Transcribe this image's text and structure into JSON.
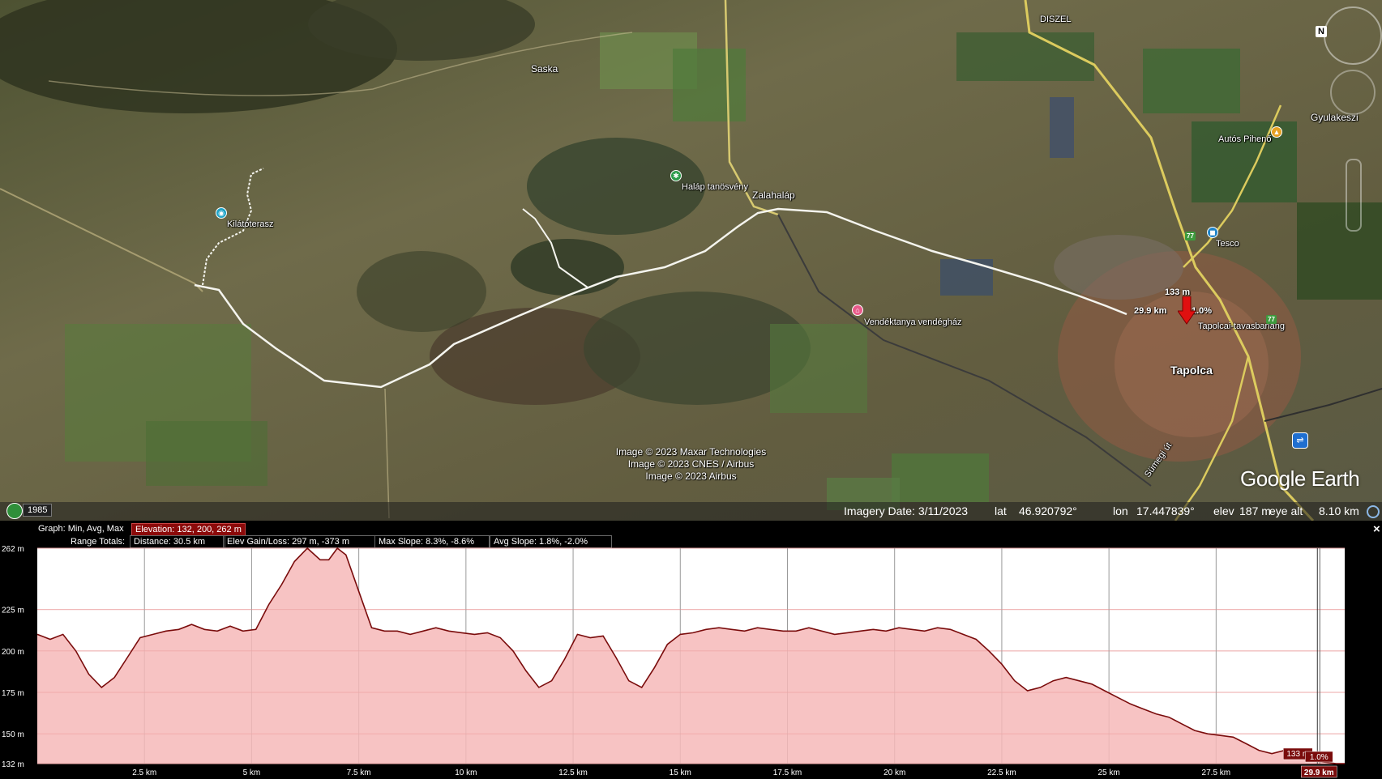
{
  "map": {
    "places": [
      {
        "name": "Saska",
        "kind": "town"
      },
      {
        "name": "DISZEL",
        "kind": "village"
      },
      {
        "name": "Gyulakeszi",
        "kind": "town"
      },
      {
        "name": "Autós Pihenő",
        "kind": "poi"
      },
      {
        "name": "Kilátóterasz",
        "kind": "poi"
      },
      {
        "name": "Haláp tanösvény",
        "kind": "poi"
      },
      {
        "name": "Zalahaláp",
        "kind": "town"
      },
      {
        "name": "Tesco",
        "kind": "poi"
      },
      {
        "name": "Vendéktanya vendégház",
        "kind": "poi"
      },
      {
        "name": "Tapolcai-tavasbarlang",
        "kind": "poi"
      },
      {
        "name": "Tapolca",
        "kind": "town"
      },
      {
        "name": "Sümegi út",
        "kind": "road"
      }
    ],
    "highway_shields": [
      "77",
      "77"
    ],
    "cursor_readout": {
      "elevation": "133 m",
      "distance": "29.9 km",
      "slope": "1.0%"
    },
    "credits": [
      "Image © 2023 Maxar Technologies",
      "Image © 2023 CNES / Airbus",
      "Image © 2023 Airbus"
    ],
    "logo": "Google Earth",
    "nav_north": "N"
  },
  "statusbar": {
    "history_year": "1985",
    "imagery_date": "Imagery Date: 3/11/2023",
    "lat_label": "lat",
    "lat": "46.920792°",
    "lon_label": "lon",
    "lon": "17.447839°",
    "elev_label": "elev",
    "elev": "187 m",
    "eye_alt_label": "eye alt",
    "eye_alt": "8.10 km"
  },
  "profile": {
    "graph_label": "Graph:",
    "graph_mode": "Min, Avg, Max",
    "elevation_stats": "Elevation: 132, 200, 262 m",
    "range_label": "Range Totals:",
    "distance": "Distance: 30.5 km",
    "elev_gain_loss": "Elev Gain/Loss: 297 m, -373 m",
    "max_slope": "Max Slope: 8.3%, -8.6%",
    "avg_slope": "Avg Slope: 1.8%, -2.0%",
    "close": "×",
    "cursor": {
      "elevation": "133 m",
      "slope": "1.0%",
      "distance": "29.9 km"
    }
  },
  "chart_data": {
    "type": "area",
    "xlabel": "",
    "ylabel": "",
    "xlim": [
      0,
      30.5
    ],
    "ylim": [
      132,
      262
    ],
    "x_ticks": [
      2.5,
      5,
      7.5,
      10,
      12.5,
      15,
      17.5,
      20,
      22.5,
      25,
      27.5
    ],
    "x_tick_labels": [
      "2.5 km",
      "5 km",
      "7.5 km",
      "10 km",
      "12.5 km",
      "15 km",
      "17.5 km",
      "20 km",
      "22.5 km",
      "25 km",
      "27.5 km"
    ],
    "y_ticks": [
      262,
      225,
      200,
      175,
      150,
      132
    ],
    "y_tick_labels": [
      "262 m",
      "225 m",
      "200 m",
      "175 m",
      "150 m",
      "132 m"
    ],
    "grid": true,
    "series": [
      {
        "color": "#7a0c0c",
        "fill": "#f6b8b8",
        "x": [
          0,
          0.3,
          0.6,
          0.9,
          1.2,
          1.5,
          1.8,
          2.1,
          2.4,
          2.7,
          3.0,
          3.3,
          3.6,
          3.9,
          4.2,
          4.5,
          4.8,
          5.1,
          5.4,
          5.7,
          6.0,
          6.3,
          6.6,
          6.8,
          7.0,
          7.2,
          7.5,
          7.8,
          8.1,
          8.4,
          8.7,
          9.0,
          9.3,
          9.6,
          9.9,
          10.2,
          10.5,
          10.8,
          11.1,
          11.4,
          11.7,
          12.0,
          12.3,
          12.6,
          12.9,
          13.2,
          13.5,
          13.8,
          14.1,
          14.4,
          14.7,
          15.0,
          15.3,
          15.6,
          15.9,
          16.2,
          16.5,
          16.8,
          17.1,
          17.4,
          17.7,
          18.0,
          18.3,
          18.6,
          18.9,
          19.2,
          19.5,
          19.8,
          20.1,
          20.4,
          20.7,
          21.0,
          21.3,
          21.6,
          21.9,
          22.2,
          22.5,
          22.8,
          23.1,
          23.4,
          23.7,
          24.0,
          24.3,
          24.6,
          24.9,
          25.2,
          25.5,
          25.8,
          26.1,
          26.4,
          26.7,
          27.0,
          27.3,
          27.6,
          27.9,
          28.2,
          28.5,
          28.8,
          29.1,
          29.4,
          29.7,
          30.0,
          30.3,
          30.5
        ],
        "y": [
          210,
          207,
          210,
          200,
          186,
          178,
          184,
          196,
          208,
          210,
          212,
          213,
          216,
          213,
          212,
          215,
          212,
          213,
          228,
          240,
          254,
          262,
          255,
          255,
          262,
          258,
          236,
          214,
          212,
          212,
          210,
          212,
          214,
          212,
          211,
          210,
          211,
          208,
          200,
          188,
          178,
          182,
          195,
          210,
          208,
          209,
          196,
          182,
          178,
          190,
          204,
          210,
          211,
          213,
          214,
          213,
          212,
          214,
          213,
          212,
          212,
          214,
          212,
          210,
          211,
          212,
          213,
          212,
          214,
          213,
          212,
          214,
          213,
          210,
          207,
          200,
          192,
          182,
          176,
          178,
          182,
          184,
          182,
          180,
          176,
          172,
          168,
          165,
          162,
          160,
          156,
          152,
          150,
          149,
          148,
          144,
          140,
          138,
          140,
          137,
          134,
          133,
          132,
          132
        ]
      }
    ]
  }
}
